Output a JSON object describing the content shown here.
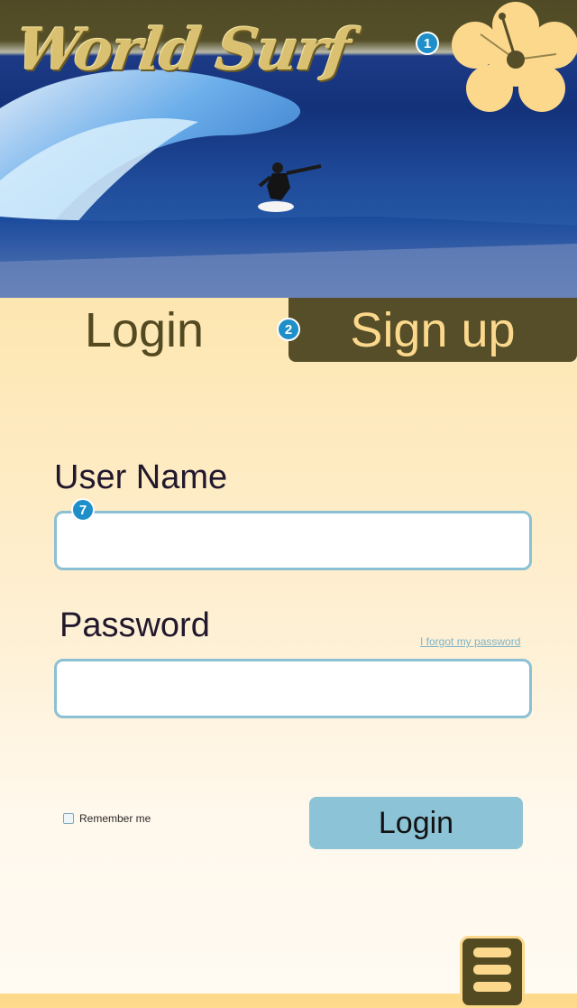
{
  "header": {
    "logo_text": "World Surf",
    "badge_1": "1"
  },
  "tabs": {
    "login_label": "Login",
    "signup_label": "Sign up",
    "badge_2": "2"
  },
  "form": {
    "username_label": "User Name",
    "username_value": "",
    "username_badge": "7",
    "password_label": "Password",
    "password_value": "",
    "forgot_link": "I forgot my password",
    "remember_label": "Remember me",
    "remember_checked": false,
    "login_button": "Login"
  },
  "icons": {
    "header_flower": "hibiscus-icon",
    "menu": "hamburger-menu-icon"
  },
  "colors": {
    "brand_olive": "#554e28",
    "brand_gold": "#fbd88c",
    "input_border": "#8cc0d4",
    "button_blue": "#8cc3d6",
    "badge_blue": "#1e8fc8"
  }
}
